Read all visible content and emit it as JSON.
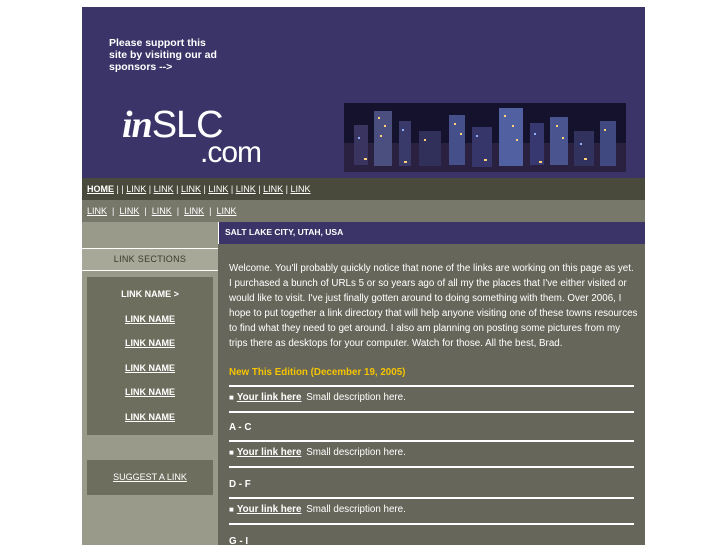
{
  "header": {
    "support_text": "Please support this site by visiting our ad sponsors -->",
    "logo_in": "in",
    "logo_slc": "SLC",
    "logo_com": ".com"
  },
  "nav_primary": {
    "home": "HOME",
    "links": [
      "LINK",
      "LINK",
      "LINK",
      "LINK",
      "LINK",
      "LINK",
      "LINK"
    ]
  },
  "nav_secondary": {
    "links": [
      "LINK",
      "LINK",
      "LINK",
      "LINK",
      "LINK"
    ]
  },
  "sidebar": {
    "section_title": "LINK SECTIONS",
    "items": [
      "LINK NAME >",
      "LINK NAME",
      "LINK NAME",
      "LINK NAME",
      "LINK NAME",
      "LINK NAME"
    ],
    "suggest_label": "SUGGEST A LINK"
  },
  "content": {
    "header": "SALT LAKE CITY, UTAH, USA",
    "welcome": "Welcome. You'll probably quickly notice that none of the links are working on this page as yet. I purchased a bunch of URLs 5 or so years ago of all my the places that I've either visited or would like to visit. I've just finally gotten around to doing something with them. Over 2006, I hope to put together a link directory that will help anyone visiting one of these towns resources to find what they need to get around. I also am planning on posting some pictures from my trips there as desktops for your computer. Watch for those. All the best, Brad.",
    "edition": "New This Edition (December 19, 2005)",
    "entries": [
      {
        "link": "Your link here",
        "desc": "Small description here."
      },
      {
        "link": "Your link here",
        "desc": "Small description here."
      },
      {
        "link": "Your link here",
        "desc": "Small description here."
      }
    ],
    "sections": [
      "A - C",
      "D - F",
      "G - I"
    ]
  },
  "colors": {
    "header_bg": "#3b3468",
    "edition_yellow": "#f5c400",
    "nav_dark": "#4a4a3c",
    "content_bg": "#66665a"
  }
}
